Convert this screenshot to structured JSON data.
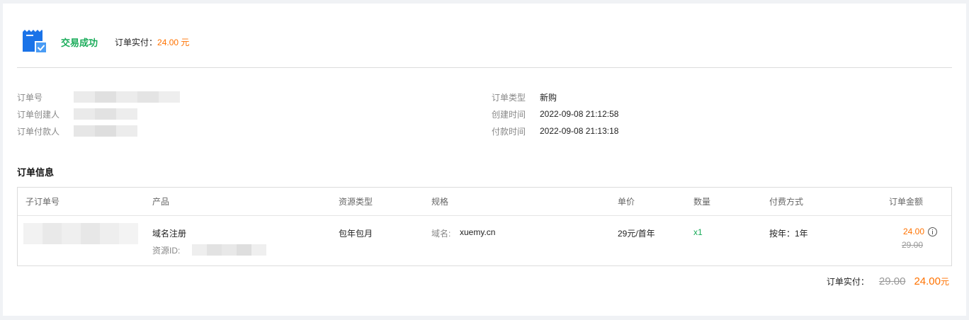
{
  "status": {
    "icon": "order-success-icon",
    "text": "交易成功",
    "paid_label": "订单实付：",
    "paid_value": "24.00 元"
  },
  "order_info_left": [
    {
      "label": "订单号",
      "value": ""
    },
    {
      "label": "订单创建人",
      "value": ""
    },
    {
      "label": "订单付款人",
      "value": ""
    }
  ],
  "order_info_right": [
    {
      "label": "订单类型",
      "value": "新购"
    },
    {
      "label": "创建时间",
      "value": "2022-09-08 21:12:58"
    },
    {
      "label": "付款时间",
      "value": "2022-09-08 21:13:18"
    }
  ],
  "section_title": "订单信息",
  "table": {
    "headers": [
      "子订单号",
      "产品",
      "资源类型",
      "规格",
      "单价",
      "数量",
      "付费方式",
      "订单金额"
    ],
    "row": {
      "sub_order_no": "",
      "product": "域名注册",
      "resource_id_label": "资源ID:",
      "resource_type": "包年包月",
      "spec_label": "域名:",
      "spec_value": "xuemy.cn",
      "unit_price": "29元/首年",
      "quantity": "x1",
      "billing": "按年：1年",
      "amount": "24.00",
      "original_amount": "29.00"
    }
  },
  "total": {
    "label": "订单实付：",
    "original": "29.00",
    "final": "24.00",
    "unit": "元"
  },
  "colors": {
    "success": "#1aac5a",
    "price": "#ff7200",
    "icon_blue": "#1a73e8"
  }
}
